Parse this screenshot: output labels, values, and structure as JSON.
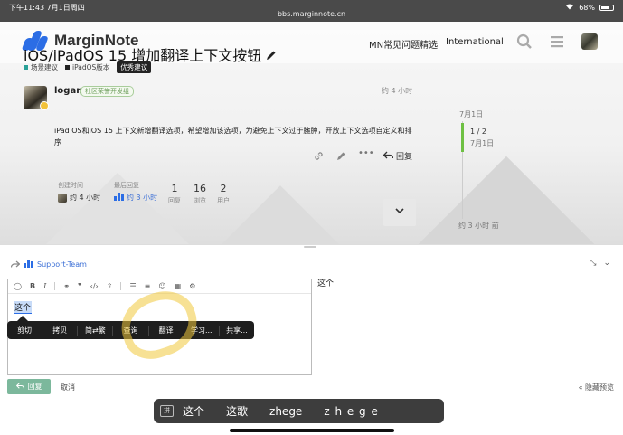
{
  "statusbar": {
    "time": "下午11:43  7月1日周四",
    "url": "bbs.marginnote.cn",
    "battery_text": "68%",
    "battery_level": 0.68,
    "signal_icon": "signal-icon",
    "wifi_icon": "wifi-icon"
  },
  "header": {
    "brand": "MarginNote",
    "faq_link": "MN常见问题精选",
    "international_link": "International",
    "search_icon": "search-icon",
    "menu_icon": "hamburger-icon"
  },
  "topic": {
    "title": "iOS/iPadOS 15 增加翻译上下文按钮",
    "categories": [
      {
        "label": "场景建议",
        "color": "#2aa198"
      },
      {
        "label": "iPadOS版本",
        "color": "#222222"
      }
    ],
    "tag": "优秀建议"
  },
  "post": {
    "username": "logan",
    "flair": "社区荣誉开发组",
    "time": "约 4 小时",
    "body": "iPad OS和iOS 15 上下文新增翻译选项，希望增加该选项，为避免上下文过于臃肿，开放上下文选项自定义和排序",
    "reply_label": "回复"
  },
  "meta": {
    "created_label": "创建时间",
    "created_value": "约 4 小时",
    "last_reply_label": "最后回复",
    "last_reply_value": "约 3 小时",
    "stats": [
      {
        "n": "1",
        "l": "回复"
      },
      {
        "n": "16",
        "l": "浏览"
      },
      {
        "n": "2",
        "l": "用户"
      }
    ]
  },
  "timeline": {
    "start": "7月1日",
    "position": "1 / 2",
    "date": "7月1日",
    "end": "约 3 小时 前"
  },
  "composer": {
    "reply_to": "Support-Team",
    "text": "这个",
    "preview": "这个",
    "context_menu": [
      "剪切",
      "拷贝",
      "简⇄繁",
      "查询",
      "翻译",
      "学习...",
      "共享..."
    ],
    "reply_button": "回复",
    "cancel": "取消",
    "hide_preview": "« 隐藏预览"
  },
  "ime": {
    "key": "拼",
    "candidates": [
      "这个",
      "这歌",
      "zhege",
      "z h e g e"
    ]
  }
}
